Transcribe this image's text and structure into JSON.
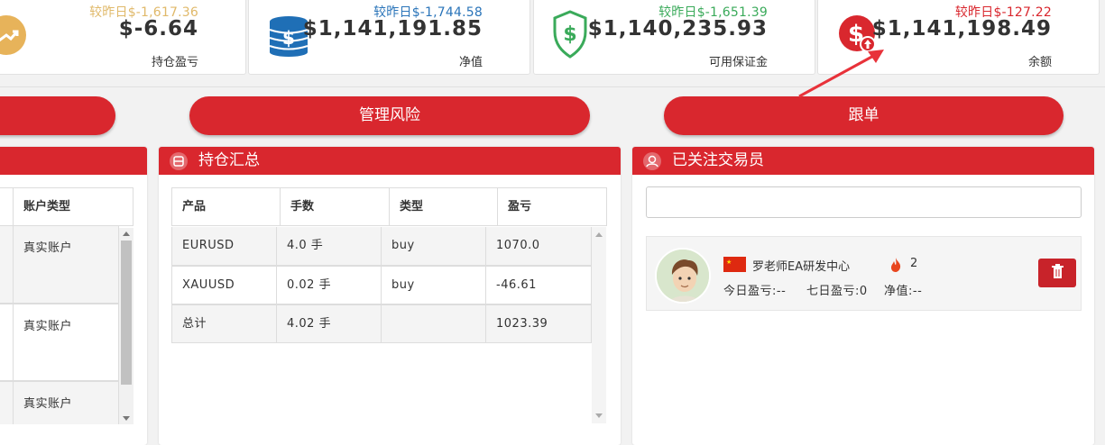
{
  "cards": [
    {
      "compare": "较昨日$-1,617.36",
      "value": "$-6.64",
      "label": "持仓盈亏",
      "compare_color": "#e0b96a",
      "icon": "trend-up-icon"
    },
    {
      "compare": "较昨日$-1,744.58",
      "value": "$1,141,191.85",
      "label": "净值",
      "compare_color": "#2a74b9",
      "icon": "coin-stack-icon"
    },
    {
      "compare": "较昨日$-1,651.39",
      "value": "$1,140,235.93",
      "label": "可用保证金",
      "compare_color": "#3aaa5a",
      "icon": "dollar-shield-icon"
    },
    {
      "compare": "较昨日$-127.22",
      "value": "$1,141,198.49",
      "label": "余额",
      "compare_color": "#d9272e",
      "icon": "dollar-up-icon"
    }
  ],
  "buttons": {
    "manage_risk": "管理风险",
    "follow": "跟单"
  },
  "accounts_panel": {
    "header": "账户类型",
    "rows": [
      "真实账户",
      "真实账户",
      "真实账户"
    ]
  },
  "positions_panel": {
    "title": "持仓汇总",
    "headers": [
      "产品",
      "手数",
      "类型",
      "盈亏"
    ],
    "rows": [
      [
        "EURUSD",
        "4.0 手",
        "buy",
        "1070.0"
      ],
      [
        "XAUUSD",
        "0.02 手",
        "buy",
        "-46.61"
      ],
      [
        "总计",
        "4.02 手",
        "",
        "1023.39"
      ]
    ]
  },
  "traders_panel": {
    "title": "已关注交易员",
    "search_value": "",
    "trader": {
      "name": "罗老师EA研发中心",
      "hot_count": "2",
      "today": "今日盈亏:--",
      "week": "七日盈亏:0",
      "equity": "净值:--"
    }
  },
  "colors": {
    "accent": "#d9272e",
    "accent_dark": "#c8232a"
  }
}
